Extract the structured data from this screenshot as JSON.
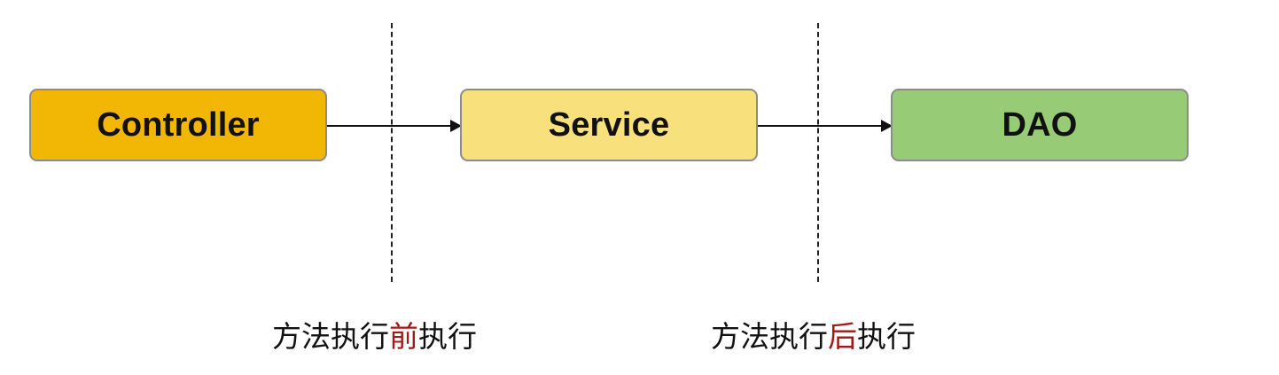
{
  "colors": {
    "controller_fill": "#f2b604",
    "service_fill": "#f8e17d",
    "dao_fill": "#98cb75",
    "node_border": "#8c8c8c",
    "highlight_text": "#a01a1a"
  },
  "nodes": {
    "controller": "Controller",
    "service": "Service",
    "dao": "DAO"
  },
  "captions": {
    "before": {
      "prefix": "方法执行",
      "highlight": "前",
      "suffix": "执行"
    },
    "after": {
      "prefix": "方法执行",
      "highlight": "后",
      "suffix": "执行"
    }
  }
}
